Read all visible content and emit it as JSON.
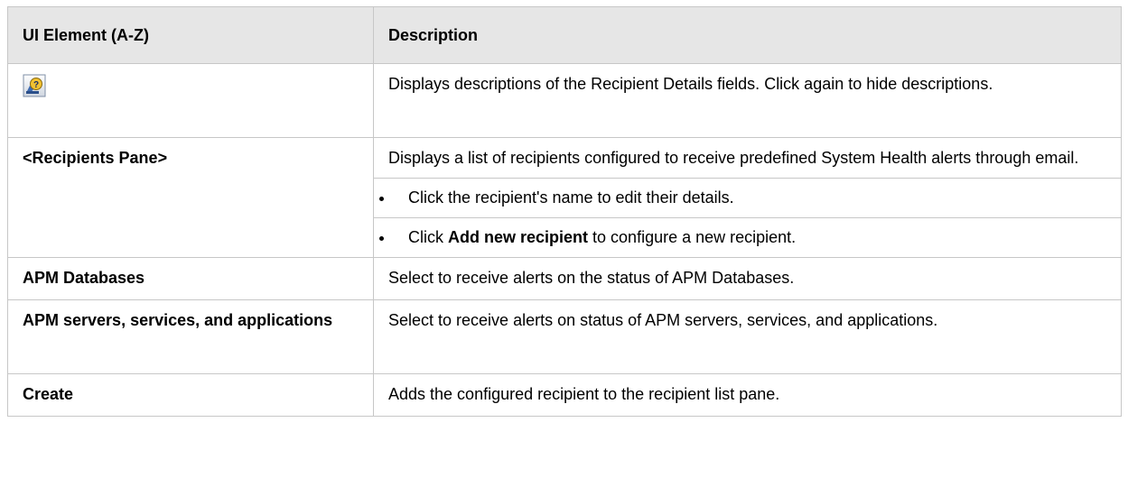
{
  "table": {
    "headers": [
      "UI Element (A-Z)",
      "Description"
    ],
    "rows": [
      {
        "element_icon": "help-descriptions-icon",
        "description": "Displays descriptions of the Recipient Details fields. Click again to hide descriptions."
      },
      {
        "element": "<Recipients Pane>",
        "description": "Displays a list of recipients configured to receive predefined System Health alerts through email.",
        "bullets": [
          {
            "text": "Click the recipient's name to edit their details."
          },
          {
            "prefix": "Click ",
            "bold": "Add new recipient",
            "suffix": " to configure a new recipient."
          }
        ]
      },
      {
        "element": "APM Databases",
        "description": "Select to receive alerts on the status of APM Databases."
      },
      {
        "element": "APM servers, services, and applications",
        "description": "Select to receive alerts on status of APM servers, services, and applications."
      },
      {
        "element": "Create",
        "description": "Adds the configured recipient to the recipient list pane."
      }
    ]
  }
}
